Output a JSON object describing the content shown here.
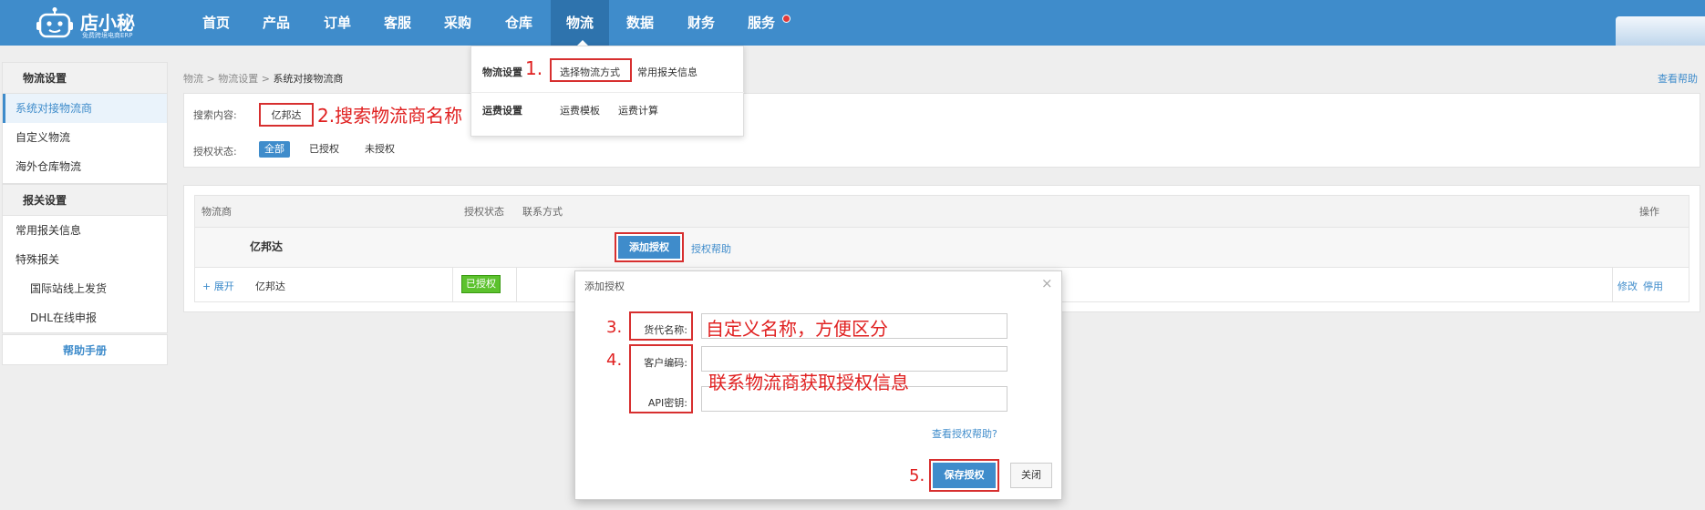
{
  "app": {
    "brand": "店小秘",
    "tagline": "免费跨境电商ERP"
  },
  "nav": {
    "items": [
      "首页",
      "产品",
      "订单",
      "客服",
      "采购",
      "仓库",
      "物流",
      "数据",
      "财务",
      "服务"
    ],
    "active": "物流"
  },
  "dropdown": {
    "section1_title": "物流设置",
    "section1_items": [
      "选择物流方式",
      "常用报关信息"
    ],
    "section2_title": "运费设置",
    "section2_items": [
      "运费模板",
      "运费计算"
    ]
  },
  "sidebar": {
    "group1_title": "物流设置",
    "group1_items": [
      "系统对接物流商",
      "自定义物流",
      "海外仓库物流"
    ],
    "group2_title": "报关设置",
    "group2_items": [
      "常用报关信息",
      "特殊报关",
      "国际站线上发货",
      "DHL在线申报"
    ],
    "help_manual": "帮助手册"
  },
  "breadcrumb": {
    "part1": "物流",
    "part2": "物流设置",
    "current": "系统对接物流商",
    "sep": ">"
  },
  "help_link": "查看帮助",
  "search": {
    "label": "搜索内容:",
    "value": "亿邦达",
    "auth_label": "授权状态:",
    "auth_options": [
      "全部",
      "已授权",
      "未授权"
    ]
  },
  "table": {
    "headers": [
      "物流商",
      "授权状态",
      "联系方式",
      "操作"
    ],
    "group_name": "亿邦达",
    "add_auth_button": "添加授权",
    "auth_help_link": "授权帮助",
    "row": {
      "expand": "+ 展开",
      "name": "亿邦达",
      "status": "已授权",
      "actions": [
        "修改",
        "停用"
      ]
    }
  },
  "modal": {
    "title": "添加授权",
    "close_glyph": "×",
    "fields": {
      "agent_name_label": "货代名称:",
      "customer_code_label": "客户编码:",
      "api_key_label": "API密钥:"
    },
    "view_help_link": "查看授权帮助?",
    "save_button": "保存授权",
    "close_button": "关闭"
  },
  "annotations": {
    "step1": "1.",
    "step2": "2.搜索物流商名称",
    "step3": "3.",
    "step3_note": "自定义名称，方便区分",
    "step4": "4.",
    "step4_note": "联系物流商获取授权信息",
    "step5": "5."
  },
  "colors": {
    "primary": "#3f8ccb",
    "annotation_red": "#d72f2f",
    "authorized_green": "#5cc22d"
  }
}
